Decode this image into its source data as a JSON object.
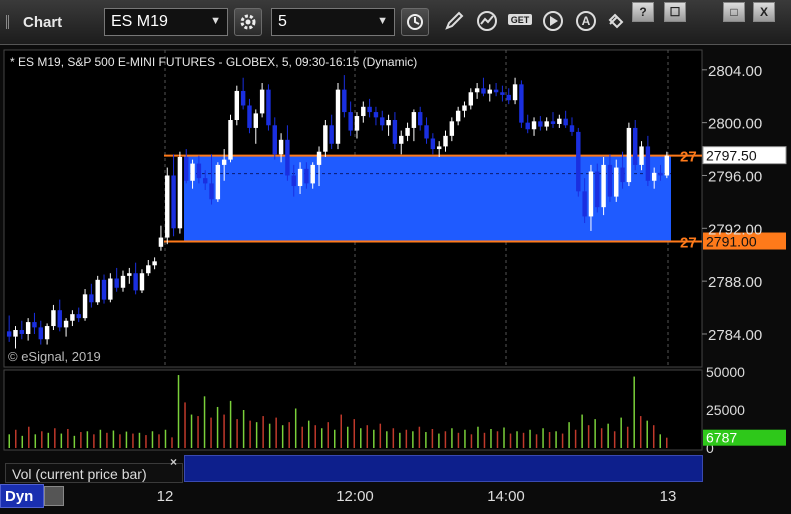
{
  "toolbar": {
    "title": "Chart",
    "symbol": "ES M19",
    "interval": "5",
    "win_help": "?",
    "win_restore": "☐",
    "win_max": "□",
    "win_close": "X"
  },
  "chart_header": "* ES M19, S&P 500 E-MINI FUTURES - GLOBEX, 5, 09:30-16:15 (Dynamic)",
  "copyright": "© eSignal, 2019",
  "volume_legend": "Vol (current price bar)",
  "volume_close": "×",
  "dyn_label": "Dyn",
  "colors": {
    "up_candle": "#ffffff",
    "down_candle": "#1a2fe0",
    "zone_fill": "#1f5bff",
    "zone_line": "#ff7a1a",
    "vol_up": "#7ad13a",
    "vol_down": "#c0392b",
    "vol_marker": "#2ec81a"
  },
  "chart_data": [
    {
      "type": "candlestick",
      "ylim": [
        2781.5,
        2805.5
      ],
      "yticks": [
        "2804.00",
        "2800.00",
        "2796.00",
        "2792.00",
        "2788.00",
        "2784.00"
      ],
      "xticks": [
        "12",
        "12:00",
        "14:00",
        "13"
      ],
      "price_marker": "2797.50",
      "zone_top": "2797.50",
      "zone_bottom": "2791.00",
      "zone_top_tag": "27",
      "zone_bottom_tag": "27",
      "candles": [
        [
          2784.2,
          2785.4,
          2783.4,
          2783.8
        ],
        [
          2783.8,
          2784.6,
          2782.9,
          2784.3
        ],
        [
          2784.3,
          2785.0,
          2783.6,
          2784.0
        ],
        [
          2784.0,
          2785.2,
          2783.5,
          2784.9
        ],
        [
          2784.9,
          2785.6,
          2784.0,
          2784.5
        ],
        [
          2784.5,
          2785.0,
          2783.2,
          2783.6
        ],
        [
          2783.6,
          2784.8,
          2783.2,
          2784.6
        ],
        [
          2784.6,
          2786.2,
          2784.3,
          2785.8
        ],
        [
          2785.8,
          2786.6,
          2784.2,
          2784.5
        ],
        [
          2784.5,
          2785.2,
          2783.8,
          2785.0
        ],
        [
          2785.0,
          2785.8,
          2784.6,
          2785.5
        ],
        [
          2785.5,
          2786.0,
          2784.9,
          2785.2
        ],
        [
          2785.2,
          2787.4,
          2785.0,
          2787.0
        ],
        [
          2787.0,
          2787.8,
          2786.0,
          2786.4
        ],
        [
          2786.4,
          2788.4,
          2786.2,
          2788.1
        ],
        [
          2788.1,
          2788.5,
          2786.3,
          2786.6
        ],
        [
          2786.6,
          2788.6,
          2786.4,
          2788.2
        ],
        [
          2788.2,
          2789.0,
          2787.2,
          2787.5
        ],
        [
          2787.5,
          2788.8,
          2787.2,
          2788.4
        ],
        [
          2788.4,
          2789.0,
          2787.8,
          2788.6
        ],
        [
          2788.6,
          2789.4,
          2787.0,
          2787.3
        ],
        [
          2787.3,
          2788.9,
          2787.1,
          2788.6
        ],
        [
          2788.6,
          2789.6,
          2788.4,
          2789.2
        ],
        [
          2789.2,
          2789.8,
          2788.9,
          2789.5
        ],
        [
          2790.6,
          2792.2,
          2790.3,
          2791.3
        ],
        [
          2791.3,
          2796.6,
          2790.8,
          2796.0
        ],
        [
          2796.0,
          2797.6,
          2791.4,
          2792.0
        ],
        [
          2792.0,
          2797.8,
          2791.6,
          2797.4
        ],
        [
          2797.4,
          2798.0,
          2795.4,
          2795.6
        ],
        [
          2795.6,
          2797.2,
          2795.0,
          2796.9
        ],
        [
          2796.9,
          2797.5,
          2795.4,
          2795.8
        ],
        [
          2795.8,
          2796.4,
          2794.9,
          2795.4
        ],
        [
          2795.4,
          2797.6,
          2793.8,
          2794.2
        ],
        [
          2794.2,
          2797.0,
          2794.0,
          2796.8
        ],
        [
          2796.8,
          2798.0,
          2795.6,
          2797.2
        ],
        [
          2797.2,
          2800.6,
          2797.0,
          2800.2
        ],
        [
          2800.2,
          2802.8,
          2799.8,
          2802.4
        ],
        [
          2802.4,
          2803.4,
          2801.0,
          2801.3
        ],
        [
          2801.3,
          2801.8,
          2799.2,
          2799.6
        ],
        [
          2799.6,
          2801.0,
          2798.4,
          2800.7
        ],
        [
          2800.7,
          2803.0,
          2800.4,
          2802.5
        ],
        [
          2802.5,
          2802.9,
          2799.4,
          2799.8
        ],
        [
          2799.8,
          2800.4,
          2797.2,
          2797.6
        ],
        [
          2797.6,
          2799.2,
          2797.0,
          2798.7
        ],
        [
          2798.7,
          2799.8,
          2795.6,
          2796.0
        ],
        [
          2796.0,
          2796.8,
          2794.4,
          2795.2
        ],
        [
          2795.2,
          2797.0,
          2794.6,
          2796.5
        ],
        [
          2796.5,
          2797.0,
          2795.0,
          2795.4
        ],
        [
          2795.4,
          2797.0,
          2795.0,
          2796.8
        ],
        [
          2796.8,
          2798.2,
          2795.2,
          2797.8
        ],
        [
          2797.8,
          2800.2,
          2797.4,
          2799.8
        ],
        [
          2799.8,
          2800.6,
          2798.0,
          2798.4
        ],
        [
          2798.4,
          2803.0,
          2798.0,
          2802.5
        ],
        [
          2802.5,
          2803.6,
          2800.4,
          2800.8
        ],
        [
          2800.8,
          2801.6,
          2799.0,
          2799.4
        ],
        [
          2799.4,
          2800.8,
          2798.8,
          2800.5
        ],
        [
          2800.5,
          2801.6,
          2800.0,
          2801.2
        ],
        [
          2801.2,
          2801.8,
          2800.4,
          2800.8
        ],
        [
          2800.8,
          2801.2,
          2799.8,
          2800.4
        ],
        [
          2800.4,
          2800.9,
          2799.4,
          2799.8
        ],
        [
          2799.8,
          2800.6,
          2799.0,
          2800.2
        ],
        [
          2800.2,
          2800.8,
          2798.0,
          2798.4
        ],
        [
          2798.4,
          2799.4,
          2797.6,
          2799.0
        ],
        [
          2799.0,
          2800.0,
          2798.6,
          2799.6
        ],
        [
          2799.6,
          2801.0,
          2798.6,
          2800.8
        ],
        [
          2800.8,
          2801.2,
          2799.4,
          2799.8
        ],
        [
          2799.8,
          2800.4,
          2798.4,
          2798.8
        ],
        [
          2798.8,
          2799.2,
          2797.6,
          2798.0
        ],
        [
          2798.0,
          2798.6,
          2797.4,
          2798.2
        ],
        [
          2798.2,
          2799.4,
          2797.8,
          2799.0
        ],
        [
          2799.0,
          2800.4,
          2798.6,
          2800.1
        ],
        [
          2800.1,
          2801.2,
          2799.8,
          2800.9
        ],
        [
          2800.9,
          2801.6,
          2800.4,
          2801.3
        ],
        [
          2801.3,
          2802.6,
          2801.0,
          2802.3
        ],
        [
          2802.3,
          2803.0,
          2801.8,
          2802.6
        ],
        [
          2802.6,
          2803.4,
          2802.0,
          2802.2
        ],
        [
          2802.2,
          2802.9,
          2801.6,
          2802.5
        ],
        [
          2802.5,
          2803.0,
          2802.0,
          2802.3
        ],
        [
          2802.3,
          2802.8,
          2801.6,
          2802.1
        ],
        [
          2802.1,
          2802.6,
          2801.4,
          2801.7
        ],
        [
          2801.7,
          2803.4,
          2801.4,
          2802.9
        ],
        [
          2802.9,
          2803.2,
          2799.6,
          2800.0
        ],
        [
          2800.0,
          2800.6,
          2799.2,
          2799.5
        ],
        [
          2799.5,
          2800.4,
          2799.0,
          2800.1
        ],
        [
          2800.1,
          2800.5,
          2799.4,
          2799.7
        ],
        [
          2799.7,
          2800.4,
          2799.4,
          2800.1
        ],
        [
          2800.1,
          2800.8,
          2799.6,
          2799.9
        ],
        [
          2799.9,
          2800.6,
          2799.6,
          2800.3
        ],
        [
          2800.3,
          2800.9,
          2799.6,
          2799.8
        ],
        [
          2799.8,
          2800.4,
          2799.0,
          2799.3
        ],
        [
          2799.3,
          2799.6,
          2794.4,
          2794.8
        ],
        [
          2794.8,
          2795.8,
          2792.4,
          2792.9
        ],
        [
          2792.9,
          2796.8,
          2791.8,
          2796.3
        ],
        [
          2796.3,
          2796.9,
          2793.2,
          2793.6
        ],
        [
          2793.6,
          2797.4,
          2793.0,
          2796.8
        ],
        [
          2796.8,
          2797.6,
          2794.0,
          2794.4
        ],
        [
          2794.4,
          2797.2,
          2794.0,
          2796.6
        ],
        [
          2796.6,
          2797.8,
          2795.0,
          2795.5
        ],
        [
          2795.5,
          2800.0,
          2795.2,
          2799.6
        ],
        [
          2799.6,
          2800.2,
          2796.4,
          2796.8
        ],
        [
          2796.8,
          2798.6,
          2796.4,
          2798.2
        ],
        [
          2798.2,
          2799.0,
          2795.2,
          2795.6
        ],
        [
          2795.6,
          2796.6,
          2795.0,
          2796.2
        ],
        [
          2796.2,
          2796.8,
          2795.6,
          2796.0
        ],
        [
          2796.0,
          2797.8,
          2795.8,
          2797.5
        ]
      ]
    },
    {
      "type": "bar",
      "ylim": [
        0,
        50000
      ],
      "yticks": [
        "50000",
        "25000",
        "0"
      ],
      "last_volume": "6787",
      "values": [
        9000,
        12000,
        8000,
        14000,
        9000,
        11000,
        10000,
        13000,
        9500,
        12500,
        8000,
        10500,
        11000,
        9000,
        12000,
        10000,
        11500,
        9000,
        10800,
        9500,
        10000,
        8500,
        11000,
        9000,
        12000,
        7000,
        48000,
        30000,
        22000,
        21000,
        34000,
        20000,
        27000,
        22000,
        31000,
        19000,
        25000,
        18000,
        17000,
        21000,
        16000,
        20000,
        15000,
        17000,
        26000,
        14000,
        18000,
        15000,
        13000,
        17000,
        12000,
        22000,
        14000,
        19000,
        13000,
        15000,
        12000,
        16000,
        11000,
        13000,
        10000,
        12000,
        11000,
        14000,
        10500,
        12500,
        9500,
        11000,
        13000,
        10000,
        12000,
        9000,
        14000,
        10000,
        12500,
        11000,
        13500,
        9500,
        11000,
        10000,
        12000,
        9000,
        13000,
        10500,
        11000,
        9500,
        17000,
        12000,
        22000,
        15000,
        19000,
        13000,
        16000,
        11000,
        20000,
        14000,
        47000,
        21000,
        18000,
        15000,
        9000,
        6787
      ]
    }
  ]
}
